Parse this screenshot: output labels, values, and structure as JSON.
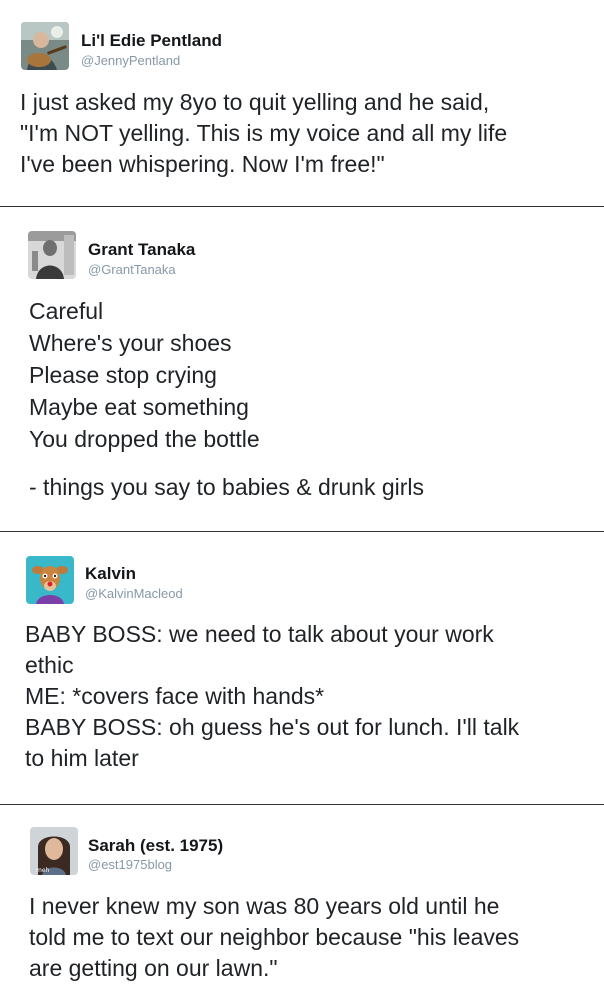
{
  "tweets": [
    {
      "name": "Li'l Edie Pentland",
      "handle": "@JennyPentland",
      "lines": [
        "I just asked my 8yo to quit yelling and he said,",
        "\"I'm NOT yelling. This is my voice and all my life",
        "I've been whispering. Now I'm free!\""
      ]
    },
    {
      "name": "Grant Tanaka",
      "handle": "@GrantTanaka",
      "lines": [
        "Careful",
        "Where's your shoes",
        "Please stop crying",
        "Maybe eat something",
        "You dropped the bottle"
      ],
      "extra_line": "- things you say to babies & drunk girls"
    },
    {
      "name": "Kalvin",
      "handle": "@KalvinMacleod",
      "lines": [
        "BABY BOSS: we need to talk about your work",
        "ethic",
        "ME: *covers face with hands*",
        "BABY BOSS: oh guess he's out for lunch. I'll talk",
        "to him later"
      ]
    },
    {
      "name": "Sarah (est. 1975)",
      "handle": "@est1975blog",
      "avatar_caption": "meh",
      "lines": [
        "I never knew my son was 80 years old until he",
        "told me to text our neighbor because \"his leaves",
        "are getting on our lawn.\""
      ]
    }
  ]
}
